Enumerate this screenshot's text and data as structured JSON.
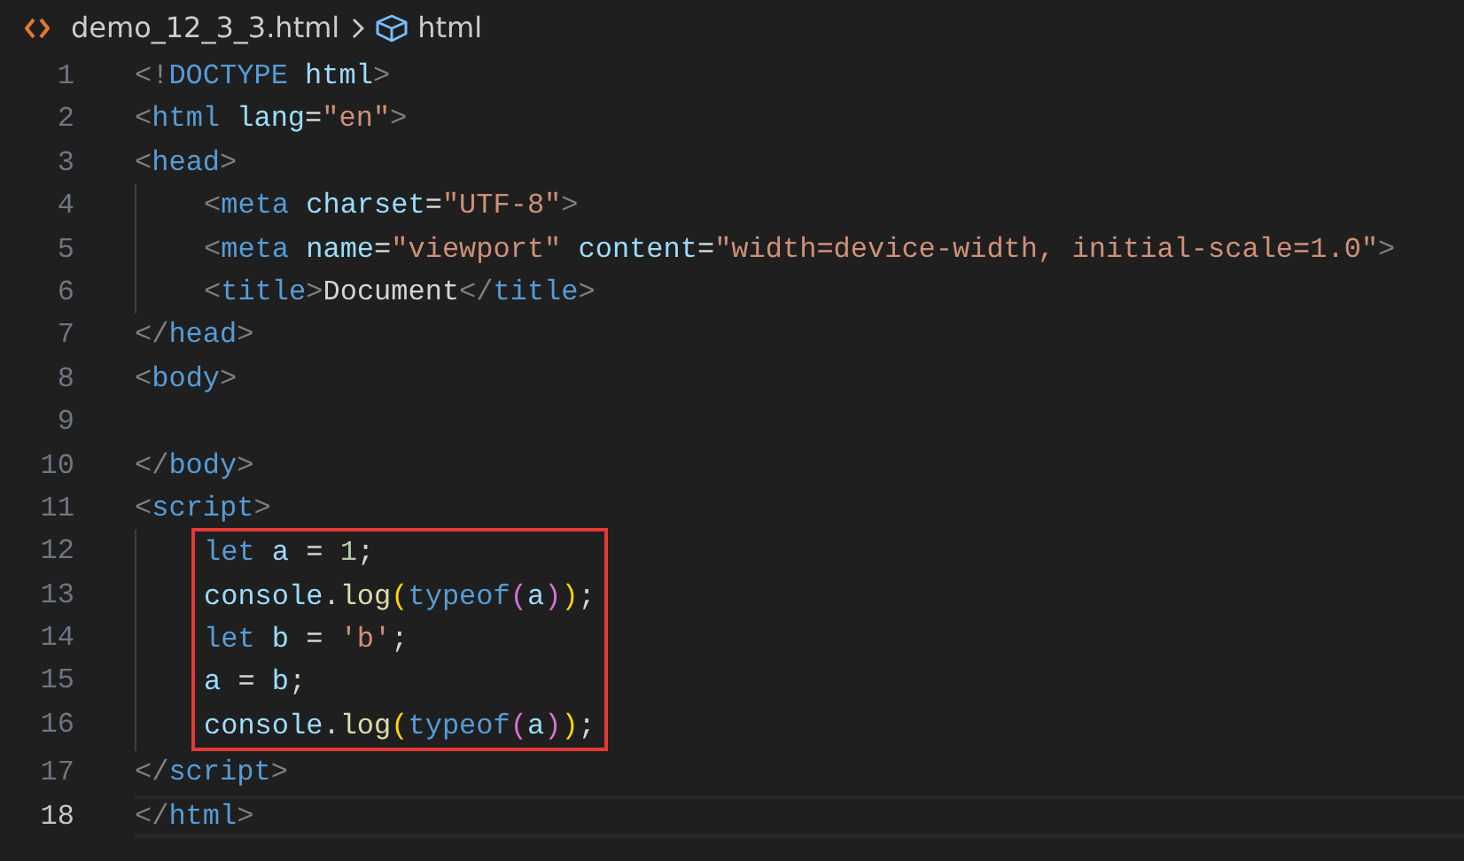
{
  "breadcrumb": {
    "file": "demo_12_3_3.html",
    "symbol": "html"
  },
  "editor": {
    "lines": [
      {
        "number": "1",
        "indented": false,
        "boxed": false,
        "current": false,
        "tokens": [
          {
            "kind": "punct",
            "text": "<!"
          },
          {
            "kind": "tag",
            "text": "DOCTYPE"
          },
          {
            "kind": "attr",
            "text": " html"
          },
          {
            "kind": "punct",
            "text": ">"
          }
        ]
      },
      {
        "number": "2",
        "indented": false,
        "boxed": false,
        "current": false,
        "tokens": [
          {
            "kind": "punct",
            "text": "<"
          },
          {
            "kind": "tag",
            "text": "html"
          },
          {
            "kind": "attr",
            "text": " lang"
          },
          {
            "kind": "plain",
            "text": "="
          },
          {
            "kind": "string",
            "text": "\"en\""
          },
          {
            "kind": "punct",
            "text": ">"
          }
        ]
      },
      {
        "number": "3",
        "indented": false,
        "boxed": false,
        "current": false,
        "tokens": [
          {
            "kind": "punct",
            "text": "<"
          },
          {
            "kind": "tag",
            "text": "head"
          },
          {
            "kind": "punct",
            "text": ">"
          }
        ]
      },
      {
        "number": "4",
        "indented": true,
        "boxed": false,
        "current": false,
        "tokens": [
          {
            "kind": "punct",
            "text": "<"
          },
          {
            "kind": "tag",
            "text": "meta"
          },
          {
            "kind": "attr",
            "text": " charset"
          },
          {
            "kind": "plain",
            "text": "="
          },
          {
            "kind": "string",
            "text": "\"UTF-8\""
          },
          {
            "kind": "punct",
            "text": ">"
          }
        ]
      },
      {
        "number": "5",
        "indented": true,
        "boxed": false,
        "current": false,
        "tokens": [
          {
            "kind": "punct",
            "text": "<"
          },
          {
            "kind": "tag",
            "text": "meta"
          },
          {
            "kind": "attr",
            "text": " name"
          },
          {
            "kind": "plain",
            "text": "="
          },
          {
            "kind": "string",
            "text": "\"viewport\""
          },
          {
            "kind": "attr",
            "text": " content"
          },
          {
            "kind": "plain",
            "text": "="
          },
          {
            "kind": "string",
            "text": "\"width=device-width, initial-scale=1.0\""
          },
          {
            "kind": "punct",
            "text": ">"
          }
        ]
      },
      {
        "number": "6",
        "indented": true,
        "boxed": false,
        "current": false,
        "tokens": [
          {
            "kind": "punct",
            "text": "<"
          },
          {
            "kind": "tag",
            "text": "title"
          },
          {
            "kind": "punct",
            "text": ">"
          },
          {
            "kind": "plain",
            "text": "Document"
          },
          {
            "kind": "punct",
            "text": "</"
          },
          {
            "kind": "tag",
            "text": "title"
          },
          {
            "kind": "punct",
            "text": ">"
          }
        ]
      },
      {
        "number": "7",
        "indented": false,
        "boxed": false,
        "current": false,
        "tokens": [
          {
            "kind": "punct",
            "text": "</"
          },
          {
            "kind": "tag",
            "text": "head"
          },
          {
            "kind": "punct",
            "text": ">"
          }
        ]
      },
      {
        "number": "8",
        "indented": false,
        "boxed": false,
        "current": false,
        "tokens": [
          {
            "kind": "punct",
            "text": "<"
          },
          {
            "kind": "tag",
            "text": "body"
          },
          {
            "kind": "punct",
            "text": ">"
          }
        ]
      },
      {
        "number": "9",
        "indented": false,
        "boxed": false,
        "current": false
      },
      {
        "number": "10",
        "indented": false,
        "boxed": false,
        "current": false,
        "tokens": [
          {
            "kind": "punct",
            "text": "</"
          },
          {
            "kind": "tag",
            "text": "body"
          },
          {
            "kind": "punct",
            "text": ">"
          }
        ]
      },
      {
        "number": "11",
        "indented": false,
        "boxed": false,
        "current": false,
        "tokens": [
          {
            "kind": "punct",
            "text": "<"
          },
          {
            "kind": "tag",
            "text": "script"
          },
          {
            "kind": "punct",
            "text": ">"
          }
        ]
      },
      {
        "number": "12",
        "indented": true,
        "boxed": true,
        "current": false,
        "tokens": [
          {
            "kind": "keyword",
            "text": "let"
          },
          {
            "kind": "variable",
            "text": " a"
          },
          {
            "kind": "plain",
            "text": " = "
          },
          {
            "kind": "number",
            "text": "1"
          },
          {
            "kind": "plain",
            "text": ";"
          }
        ]
      },
      {
        "number": "13",
        "indented": true,
        "boxed": true,
        "current": false,
        "tokens": [
          {
            "kind": "variable",
            "text": "console"
          },
          {
            "kind": "plain",
            "text": "."
          },
          {
            "kind": "function",
            "text": "log"
          },
          {
            "kind": "bracket1",
            "text": "("
          },
          {
            "kind": "keyword",
            "text": "typeof"
          },
          {
            "kind": "bracket2",
            "text": "("
          },
          {
            "kind": "variable",
            "text": "a"
          },
          {
            "kind": "bracket2",
            "text": ")"
          },
          {
            "kind": "bracket1",
            "text": ")"
          },
          {
            "kind": "plain",
            "text": ";"
          }
        ]
      },
      {
        "number": "14",
        "indented": true,
        "boxed": true,
        "current": false,
        "tokens": [
          {
            "kind": "keyword",
            "text": "let"
          },
          {
            "kind": "variable",
            "text": " b"
          },
          {
            "kind": "plain",
            "text": " = "
          },
          {
            "kind": "string",
            "text": "'b'"
          },
          {
            "kind": "plain",
            "text": ";"
          }
        ]
      },
      {
        "number": "15",
        "indented": true,
        "boxed": true,
        "current": false,
        "tokens": [
          {
            "kind": "variable",
            "text": "a"
          },
          {
            "kind": "plain",
            "text": " = "
          },
          {
            "kind": "variable",
            "text": "b"
          },
          {
            "kind": "plain",
            "text": ";"
          }
        ]
      },
      {
        "number": "16",
        "indented": true,
        "boxed": true,
        "current": false,
        "tokens": [
          {
            "kind": "variable",
            "text": "console"
          },
          {
            "kind": "plain",
            "text": "."
          },
          {
            "kind": "function",
            "text": "log"
          },
          {
            "kind": "bracket1",
            "text": "("
          },
          {
            "kind": "keyword",
            "text": "typeof"
          },
          {
            "kind": "bracket2",
            "text": "("
          },
          {
            "kind": "variable",
            "text": "a"
          },
          {
            "kind": "bracket2",
            "text": ")"
          },
          {
            "kind": "bracket1",
            "text": ")"
          },
          {
            "kind": "plain",
            "text": ";"
          }
        ]
      },
      {
        "number": "17",
        "indented": false,
        "boxed": false,
        "current": false,
        "tokens": [
          {
            "kind": "punct",
            "text": "</"
          },
          {
            "kind": "tag",
            "text": "script"
          },
          {
            "kind": "punct",
            "text": ">"
          }
        ]
      },
      {
        "number": "18",
        "indented": false,
        "boxed": false,
        "current": true,
        "tokens": [
          {
            "kind": "punct",
            "text": "</"
          },
          {
            "kind": "tag",
            "text": "html"
          },
          {
            "kind": "punct",
            "text": ">"
          }
        ]
      }
    ]
  }
}
